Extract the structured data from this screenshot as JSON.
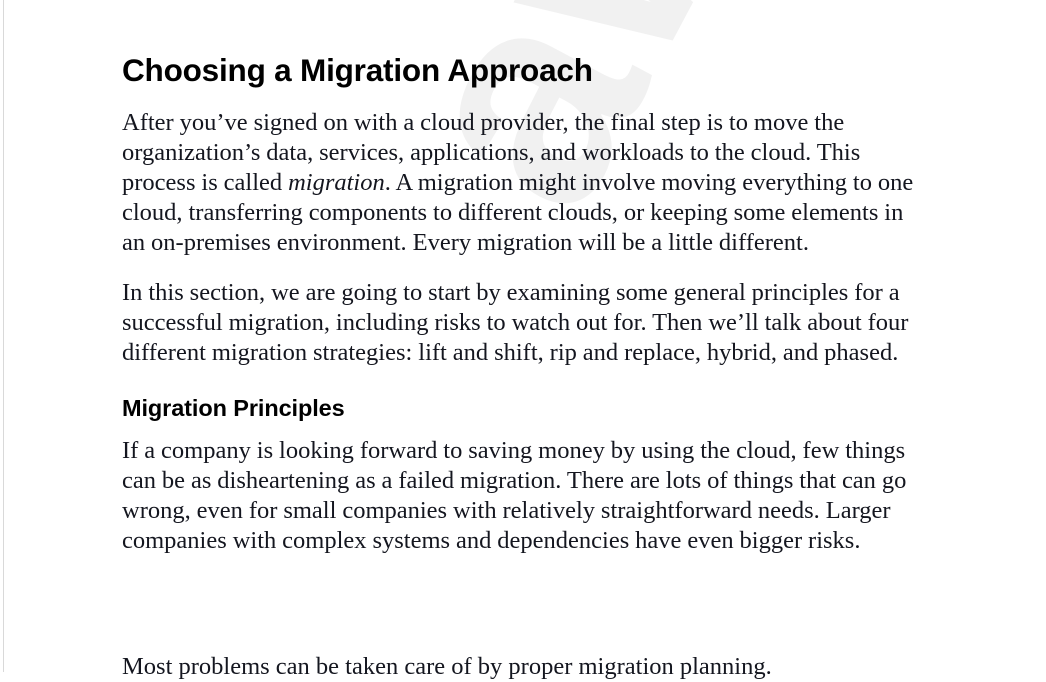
{
  "document": {
    "type": "book-page",
    "heading": "Choosing a Migration Approach",
    "subheading": "Migration Principles",
    "paragraphs": {
      "intro_part1": "After you’ve signed on with a cloud provider, the final step is to move the organization’s data, services, applications, and workloads to the cloud. This process is called ",
      "intro_emphasis": "migration",
      "intro_part2": ". A migration might involve moving everything to one cloud, transferring components to different clouds, or keeping some elements in an on-premises environment. Every migration will be a little different.",
      "section_overview": "In this section, we are going to start by examining some general principles for a successful migration, including risks to watch out for. Then we’ll talk about four different migration strategies: lift and shift, rip and replace, hybrid, and phased.",
      "principles_body": "If a company is looking forward to saving money by using the cloud, few things can be as disheartening as a failed migration. There are lots of things that can go wrong, even for small companies with relatively straightforward needs. Larger companies with complex systems and dependencies have even bigger risks.",
      "clipped_last_line": "Most problems can be taken care of by proper migration planning."
    },
    "watermark": {
      "text": "away",
      "color": "#f1f1f1"
    },
    "colors": {
      "page_background": "#ffffff",
      "body_text": "#14161f",
      "heading_text": "#000000",
      "page_edge": "#d9d9d9"
    }
  }
}
